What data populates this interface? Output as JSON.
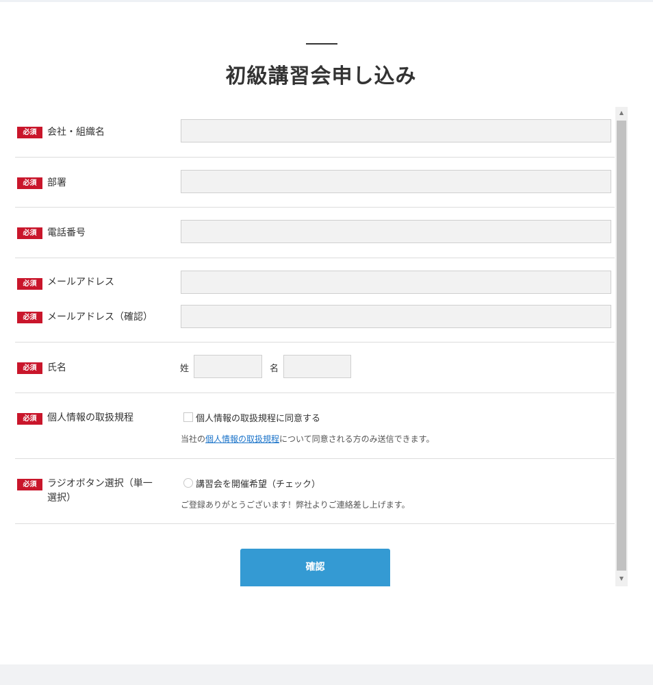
{
  "page": {
    "title": "初級講習会申し込み"
  },
  "form": {
    "required_label": "必須",
    "fields": {
      "company": {
        "label": "会社・組織名",
        "value": ""
      },
      "department": {
        "label": "部署",
        "value": ""
      },
      "phone": {
        "label": "電話番号",
        "value": ""
      },
      "email": {
        "label": "メールアドレス",
        "value": ""
      },
      "email_confirm": {
        "label": "メールアドレス（確認）",
        "value": ""
      },
      "name": {
        "label": "氏名",
        "last_label": "姓",
        "first_label": "名",
        "last_value": "",
        "first_value": ""
      },
      "privacy": {
        "label": "個人情報の取扱規程",
        "checkbox_label": "個人情報の取扱規程に同意する",
        "note_prefix": "当社の",
        "note_link": "個人情報の取扱規程",
        "note_suffix": "について同意される方のみ送信できます。"
      },
      "radio": {
        "label_line1": "ラジオボタン選択（単一",
        "label_line2": "選択）",
        "option_label": "講習会を開催希望（チェック）",
        "note": "ご登録ありがとうございます！弊社よりご連絡差し上げます。"
      }
    },
    "submit_label": "確認"
  },
  "colors": {
    "required_badge": "#c9162b",
    "button": "#349ad3",
    "link": "#1a73c9"
  },
  "icons": {
    "scroll_up": "triangle-up-icon",
    "scroll_down": "triangle-down-icon"
  }
}
